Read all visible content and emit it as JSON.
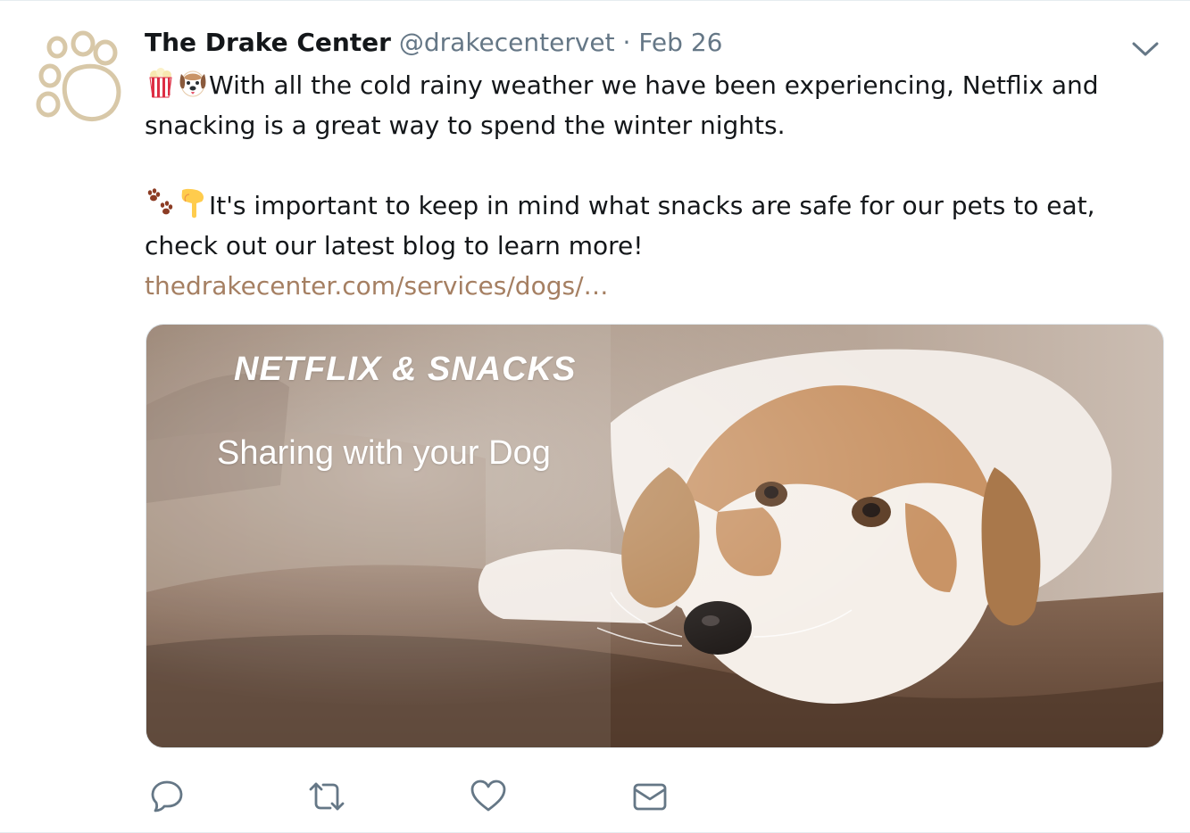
{
  "tweet": {
    "name": "The Drake Center",
    "handle": "@drakecentervet",
    "separator": "·",
    "date": "Feb 26",
    "text": {
      "line1": "With all the cold rainy weather we have been experiencing, Netflix and",
      "line2": "snacking is a great way to spend the winter nights.",
      "line3": "It's important to keep in mind what snacks are safe for our pets to eat,",
      "line4": "check out our latest blog to learn more!",
      "link": "thedrakecenter.com/services/dogs/…"
    },
    "emojis": [
      "popcorn-emoji",
      "dog-face-emoji",
      "paw-prints-emoji",
      "pointing-down-emoji"
    ],
    "card": {
      "title": "NETFLIX & SNACKS",
      "subtitle": "Sharing with your Dog"
    },
    "actions": [
      "reply-icon",
      "retweet-icon",
      "like-icon",
      "direct-message-icon"
    ],
    "colors": {
      "name": "#14171a",
      "secondary": "#657786",
      "link": "#a57f62",
      "icon": "#657786",
      "avatar_ring": "#d8c8a8"
    }
  }
}
